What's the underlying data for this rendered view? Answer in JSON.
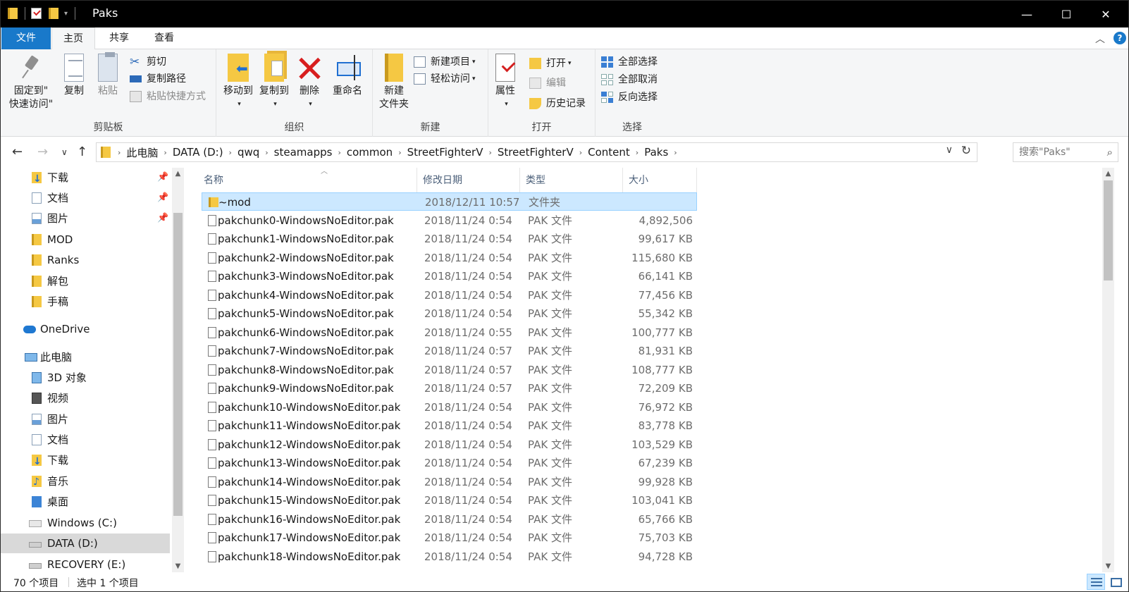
{
  "window": {
    "title": "Paks",
    "controls": {
      "minimize": "—",
      "maximize": "☐",
      "close": "✕"
    }
  },
  "ribbon_tabs": [
    {
      "label": "文件"
    },
    {
      "label": "主页"
    },
    {
      "label": "共享"
    },
    {
      "label": "查看"
    }
  ],
  "ribbon": {
    "clipboard": {
      "label": "剪贴板",
      "pin": "固定到\"\n快速访问\"",
      "pin_line1": "固定到\"",
      "pin_line2": "快速访问\"",
      "copy": "复制",
      "paste": "粘贴",
      "cut": "剪切",
      "copy_path": "复制路径",
      "paste_shortcut": "粘贴快捷方式"
    },
    "organize": {
      "label": "组织",
      "move_to": "移动到",
      "copy_to": "复制到",
      "delete": "删除",
      "rename": "重命名"
    },
    "new": {
      "label": "新建",
      "new_folder_line1": "新建",
      "new_folder_line2": "文件夹",
      "new_item": "新建项目",
      "easy_access": "轻松访问"
    },
    "open": {
      "label": "打开",
      "properties": "属性",
      "open": "打开",
      "edit": "编辑",
      "history": "历史记录"
    },
    "select": {
      "label": "选择",
      "select_all": "全部选择",
      "select_none": "全部取消",
      "invert": "反向选择"
    }
  },
  "address": {
    "crumbs": [
      "此电脑",
      "DATA (D:)",
      "qwq",
      "steamapps",
      "common",
      "StreetFighterV",
      "StreetFighterV",
      "Content",
      "Paks"
    ],
    "search_placeholder": "搜索\"Paks\""
  },
  "nav": {
    "quick_access": [
      {
        "label": "下载",
        "icon": "download-folder-icon",
        "pinned": true
      },
      {
        "label": "文档",
        "icon": "documents-icon",
        "pinned": true
      },
      {
        "label": "图片",
        "icon": "pictures-icon",
        "pinned": true
      },
      {
        "label": "MOD",
        "icon": "folder-icon"
      },
      {
        "label": "Ranks",
        "icon": "folder-icon"
      },
      {
        "label": "解包",
        "icon": "folder-icon"
      },
      {
        "label": "手稿",
        "icon": "folder-icon"
      }
    ],
    "onedrive": "OneDrive",
    "this_pc": "此电脑",
    "pc_items": [
      {
        "label": "3D 对象",
        "icon": "3d-objects-icon"
      },
      {
        "label": "视频",
        "icon": "videos-icon"
      },
      {
        "label": "图片",
        "icon": "pictures-icon"
      },
      {
        "label": "文档",
        "icon": "documents-icon"
      },
      {
        "label": "下载",
        "icon": "download-folder-icon"
      },
      {
        "label": "音乐",
        "icon": "music-icon"
      },
      {
        "label": "桌面",
        "icon": "desktop-icon"
      },
      {
        "label": "Windows (C:)",
        "icon": "windows-drive-icon"
      },
      {
        "label": "DATA (D:)",
        "icon": "drive-icon",
        "selected": true
      },
      {
        "label": "RECOVERY (E:)",
        "icon": "drive-icon"
      }
    ]
  },
  "columns": {
    "name": "名称",
    "date": "修改日期",
    "type": "类型",
    "size": "大小"
  },
  "files": [
    {
      "name": "~mod",
      "date": "2018/12/11 10:57",
      "type": "文件夹",
      "size": "",
      "folder": true,
      "selected": true
    },
    {
      "name": "pakchunk0-WindowsNoEditor.pak",
      "date": "2018/11/24 0:54",
      "type": "PAK 文件",
      "size": "4,892,506"
    },
    {
      "name": "pakchunk1-WindowsNoEditor.pak",
      "date": "2018/11/24 0:54",
      "type": "PAK 文件",
      "size": "99,617 KB"
    },
    {
      "name": "pakchunk2-WindowsNoEditor.pak",
      "date": "2018/11/24 0:54",
      "type": "PAK 文件",
      "size": "115,680 KB"
    },
    {
      "name": "pakchunk3-WindowsNoEditor.pak",
      "date": "2018/11/24 0:54",
      "type": "PAK 文件",
      "size": "66,141 KB"
    },
    {
      "name": "pakchunk4-WindowsNoEditor.pak",
      "date": "2018/11/24 0:54",
      "type": "PAK 文件",
      "size": "77,456 KB"
    },
    {
      "name": "pakchunk5-WindowsNoEditor.pak",
      "date": "2018/11/24 0:54",
      "type": "PAK 文件",
      "size": "55,342 KB"
    },
    {
      "name": "pakchunk6-WindowsNoEditor.pak",
      "date": "2018/11/24 0:55",
      "type": "PAK 文件",
      "size": "100,777 KB"
    },
    {
      "name": "pakchunk7-WindowsNoEditor.pak",
      "date": "2018/11/24 0:57",
      "type": "PAK 文件",
      "size": "81,931 KB"
    },
    {
      "name": "pakchunk8-WindowsNoEditor.pak",
      "date": "2018/11/24 0:57",
      "type": "PAK 文件",
      "size": "108,777 KB"
    },
    {
      "name": "pakchunk9-WindowsNoEditor.pak",
      "date": "2018/11/24 0:57",
      "type": "PAK 文件",
      "size": "72,209 KB"
    },
    {
      "name": "pakchunk10-WindowsNoEditor.pak",
      "date": "2018/11/24 0:54",
      "type": "PAK 文件",
      "size": "76,972 KB"
    },
    {
      "name": "pakchunk11-WindowsNoEditor.pak",
      "date": "2018/11/24 0:54",
      "type": "PAK 文件",
      "size": "83,778 KB"
    },
    {
      "name": "pakchunk12-WindowsNoEditor.pak",
      "date": "2018/11/24 0:54",
      "type": "PAK 文件",
      "size": "103,529 KB"
    },
    {
      "name": "pakchunk13-WindowsNoEditor.pak",
      "date": "2018/11/24 0:54",
      "type": "PAK 文件",
      "size": "67,239 KB"
    },
    {
      "name": "pakchunk14-WindowsNoEditor.pak",
      "date": "2018/11/24 0:54",
      "type": "PAK 文件",
      "size": "99,928 KB"
    },
    {
      "name": "pakchunk15-WindowsNoEditor.pak",
      "date": "2018/11/24 0:54",
      "type": "PAK 文件",
      "size": "103,041 KB"
    },
    {
      "name": "pakchunk16-WindowsNoEditor.pak",
      "date": "2018/11/24 0:54",
      "type": "PAK 文件",
      "size": "65,766 KB"
    },
    {
      "name": "pakchunk17-WindowsNoEditor.pak",
      "date": "2018/11/24 0:54",
      "type": "PAK 文件",
      "size": "75,703 KB"
    },
    {
      "name": "pakchunk18-WindowsNoEditor.pak",
      "date": "2018/11/24 0:54",
      "type": "PAK 文件",
      "size": "94,728 KB"
    }
  ],
  "status": {
    "count": "70 个项目",
    "selected": "选中 1 个项目"
  },
  "colors": {
    "accent": "#1979ca",
    "selection": "#cce8ff",
    "title_bar": "#000000"
  }
}
